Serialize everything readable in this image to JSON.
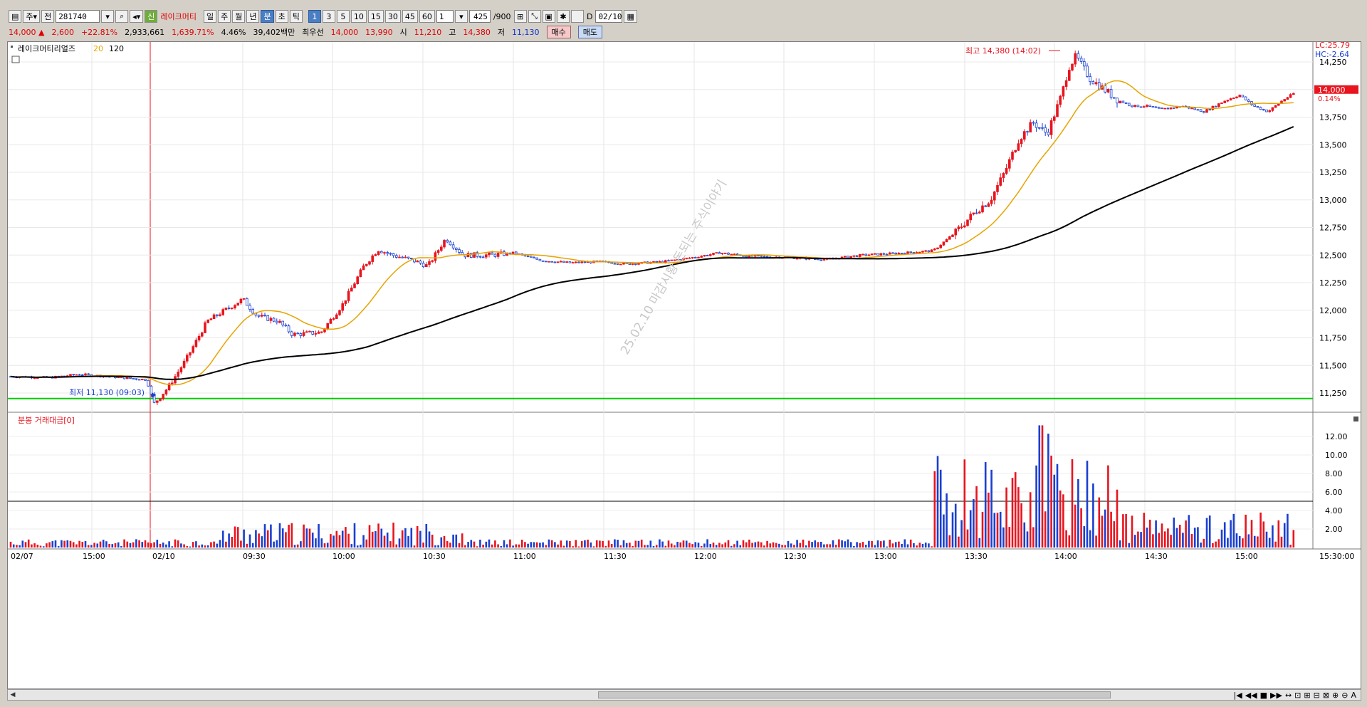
{
  "toolbar": {
    "period_main": "주",
    "code_prefix": "전",
    "stock_code": "281740",
    "stock_badge": "신",
    "stock_name_short": "레이크머티",
    "period_buttons": [
      "일",
      "주",
      "월",
      "년",
      "분",
      "초",
      "틱"
    ],
    "active_period": "분",
    "interval_buttons": [
      "1",
      "3",
      "5",
      "10",
      "15",
      "30",
      "45",
      "60"
    ],
    "active_interval": "1",
    "interval_select": "1",
    "count_display": "425",
    "count_total": "/900",
    "date_label": "D",
    "date_value": "02/10"
  },
  "infobar": {
    "price": "14,000",
    "change": "2,600",
    "change_pct": "+22.81%",
    "volume": "2,933,661",
    "volume_pct": "1,639.71%",
    "turnover_pct": "4.46%",
    "amount": "39,402백만",
    "best_label": "최우선",
    "ask": "14,000",
    "bid": "13,990",
    "open_label": "시",
    "open": "11,210",
    "high_label": "고",
    "high": "14,380",
    "low_label": "저",
    "low": "11,130",
    "sell_label": "매수",
    "buy_label": "매도"
  },
  "legend": {
    "stock_name": "레이크머티리얼즈",
    "ma1": "20",
    "ma2": "120"
  },
  "annotations": {
    "high_marker": "최고 14,380 (14:02)",
    "low_marker": "최저 11,130 (09:03)",
    "lc": "LC:25.79",
    "hc": "HC:-2.64",
    "current_price_tag": "14,000",
    "current_pct_tag": "0.14%",
    "watermark": "25.02.10 마감시황 돈되는 주식이야기"
  },
  "volume_panel": {
    "title": "분봉 거래대금[0]"
  },
  "colors": {
    "up": "#e8141e",
    "down": "#1a3fd0",
    "ma20": "#e6a400",
    "ma120": "#000000",
    "support_line": "#00cc00"
  },
  "chart_data": [
    {
      "type": "candlestick",
      "title": "레이크머티리얼즈",
      "x_ticks": [
        "02/07",
        "15:00",
        "02/10",
        "09:30",
        "10:00",
        "10:30",
        "11:00",
        "11:30",
        "12:00",
        "12:30",
        "13:00",
        "13:30",
        "14:00",
        "14:30",
        "15:00"
      ],
      "ylim": [
        11130,
        14380
      ],
      "y_ticks": [
        "11,250",
        "11,500",
        "11,750",
        "12,000",
        "12,250",
        "12,500",
        "12,750",
        "13,000",
        "13,250",
        "13,500",
        "13,750",
        "14,000",
        "14,250"
      ],
      "series": [
        {
          "name": "20",
          "type": "line"
        },
        {
          "name": "120",
          "type": "line"
        }
      ],
      "open": 11210,
      "high": 14380,
      "low": 11130,
      "close": 14000,
      "support_level": 11200
    },
    {
      "type": "bar",
      "title": "분봉 거래대금[0]",
      "y_ticks": [
        "2.00",
        "4.00",
        "6.00",
        "8.00",
        "10.00",
        "12.00"
      ],
      "ylim": [
        0,
        13.5
      ],
      "reference_level": 5
    }
  ],
  "scrollbar": {
    "tools": [
      "|◀",
      "◀◀",
      "■",
      "▶▶",
      "↔",
      "⊡",
      "⊞",
      "⊟",
      "⊠",
      "⊕",
      "⊖",
      "A"
    ]
  }
}
